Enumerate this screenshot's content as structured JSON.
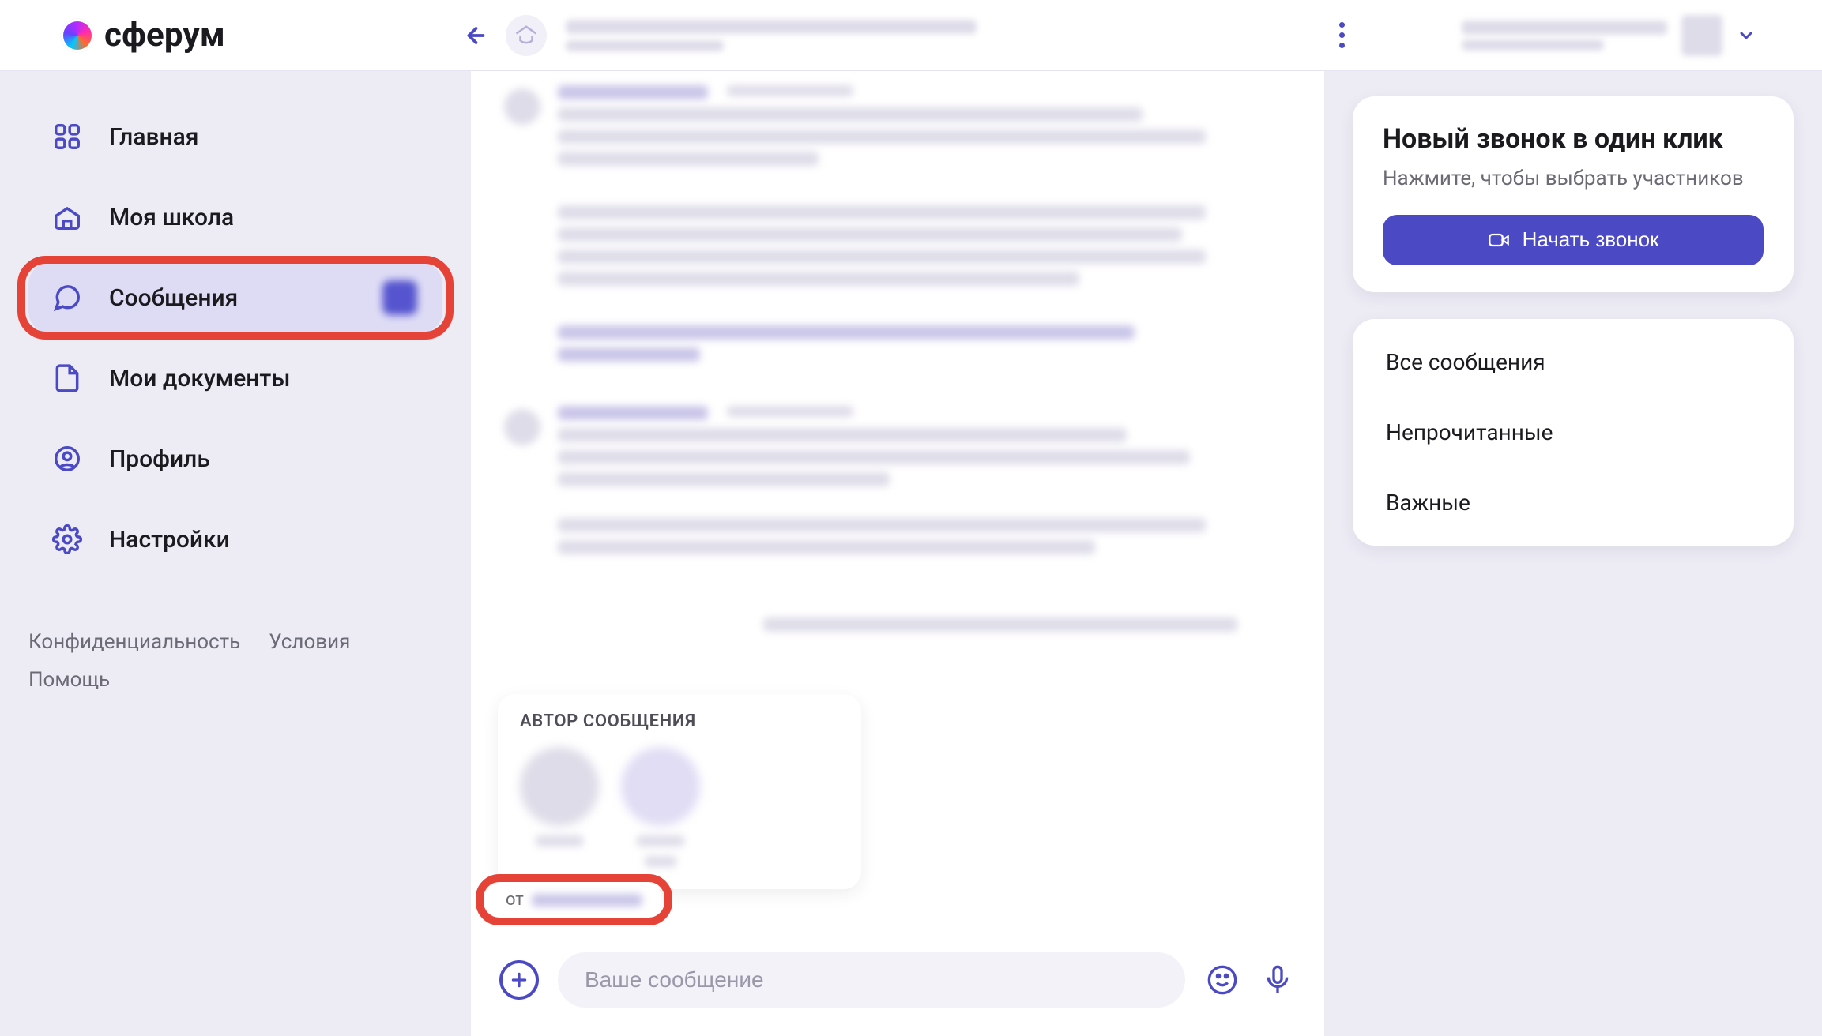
{
  "brand": "сферум",
  "sidebar": {
    "items": [
      {
        "label": "Главная"
      },
      {
        "label": "Моя школа"
      },
      {
        "label": "Сообщения"
      },
      {
        "label": "Мои документы"
      },
      {
        "label": "Профиль"
      },
      {
        "label": "Настройки"
      }
    ],
    "footer": {
      "privacy": "Конфиденциальность",
      "terms": "Условия",
      "help": "Помощь"
    }
  },
  "popover": {
    "title": "АВТОР СООБЩЕНИЯ"
  },
  "reply_chip": {
    "prefix": "от"
  },
  "composer": {
    "placeholder": "Ваше сообщение"
  },
  "call_card": {
    "title": "Новый звонок в один клик",
    "subtitle": "Нажмите, чтобы выбрать участников",
    "button": "Начать звонок"
  },
  "filters": {
    "all": "Все сообщения",
    "unread": "Непрочитанные",
    "important": "Важные"
  }
}
